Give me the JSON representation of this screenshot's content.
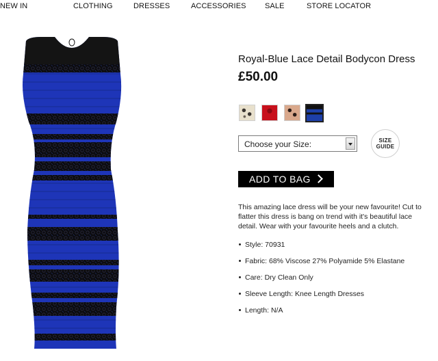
{
  "nav": {
    "items": [
      "NEW IN",
      "CLOTHING",
      "DRESSES",
      "ACCESSORIES",
      "SALE",
      "STORE LOCATOR"
    ]
  },
  "product": {
    "title": "Royal-Blue Lace Detail Bodycon Dress",
    "price": "£50.00",
    "image_alt": "blue and black lace bodycon dress",
    "swatches": [
      {
        "name": "cream lace",
        "color": "#e8e0cc",
        "selected": false
      },
      {
        "name": "red",
        "color": "#c8101c",
        "selected": false
      },
      {
        "name": "nude lace",
        "color": "#d9a88c",
        "selected": false
      },
      {
        "name": "royal blue",
        "color": "#1d3fa8",
        "selected": true
      }
    ],
    "size_select": {
      "selected": "Choose your Size:"
    },
    "size_guide": {
      "line1": "SIZE",
      "line2": "GUIDE"
    },
    "add_to_bag": "ADD TO BAG",
    "description": "This amazing lace dress will be your new favourite! Cut to flatter this dress is bang on trend with it's beautiful lace detail. Wear with your favourite heels and a clutch.",
    "specs": [
      "Style: 70931",
      "Fabric: 68% Viscose 27% Polyamide 5% Elastane",
      "Care: Dry Clean Only",
      "Sleeve Length: Knee Length Dresses",
      "Length: N/A"
    ]
  },
  "colors": {
    "dress_blue": "#1e35b8",
    "dress_black": "#111111",
    "button_bg": "#000000"
  }
}
